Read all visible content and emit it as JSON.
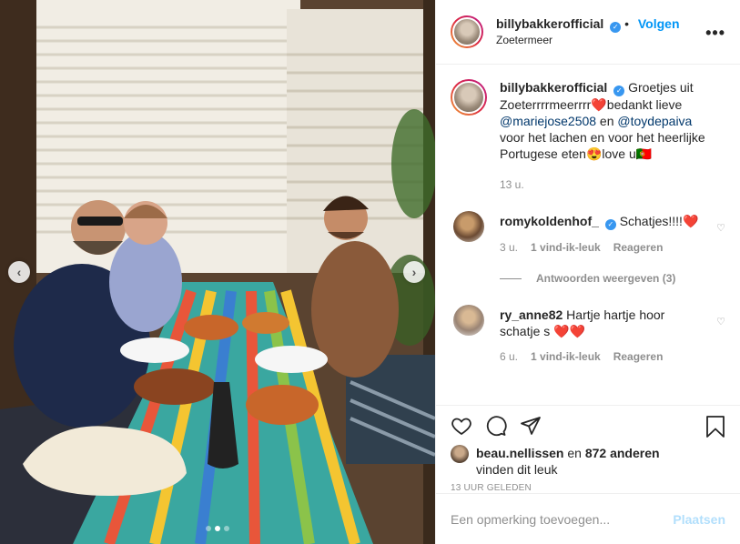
{
  "post": {
    "username": "billybakkerofficial",
    "verified_symbol": "✓",
    "follow_label": "Volgen",
    "location": "Zoetermeer",
    "more_label": "•••",
    "caption": {
      "text_1": "Groetjes uit Zoeterrrrmeerrrr",
      "heart": "❤️",
      "text_2": "bedankt lieve ",
      "mention_1": "@mariejose2508",
      "text_3": " en ",
      "mention_2": "@toydepaiva",
      "text_4": " voor het lachen en voor het heerlijke Portugese eten",
      "emoji": "😍",
      "text_5": "love u",
      "trailing_glyph": "🇵🇹",
      "time": "13 u."
    }
  },
  "comments": [
    {
      "username": "romykoldenhof_",
      "verified_symbol": "✓",
      "text": "Schatjes!!!!",
      "hearts": "❤️",
      "time": "3 u.",
      "likes": "1 vind-ik-leuk",
      "reply": "Reageren",
      "replies_label": "Antwoorden weergeven (3)"
    },
    {
      "username": "ry_anne82",
      "text": "Hartje hartje hoor schatje s ",
      "hearts": "❤️❤️",
      "time": "6 u.",
      "likes": "1 vind-ik-leuk",
      "reply": "Reageren"
    }
  ],
  "likes_line": {
    "user": "beau.nellissen",
    "middle": " en ",
    "others": "872 anderen",
    "suffix": "vinden dit leuk"
  },
  "timestamp": "13 UUR GELEDEN",
  "add_comment": {
    "placeholder": "Een opmerking toevoegen...",
    "post_label": "Plaatsen"
  },
  "carousel": {
    "prev_label": "‹",
    "next_label": "›",
    "slide_count": 3,
    "active_slide": 2
  },
  "icons": [
    "heart-icon",
    "comment-icon",
    "share-icon",
    "bookmark-icon",
    "more-icon",
    "chevron-left-icon",
    "chevron-right-icon"
  ]
}
